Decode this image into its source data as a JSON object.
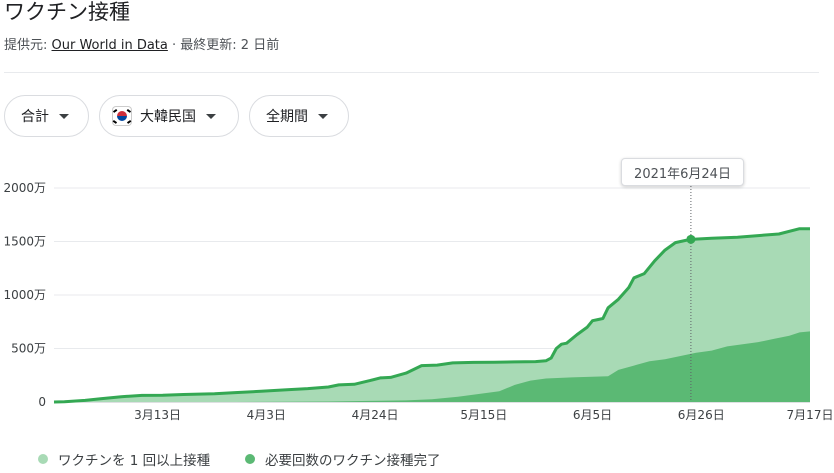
{
  "header": {
    "title": "ワクチン接種",
    "source_prefix": "提供元: ",
    "source_link": "Our World in Data",
    "source_suffix": " · 最終更新: 2 日前"
  },
  "filters": {
    "total_label": "合計",
    "country_label": "大韓民国",
    "period_label": "全期間"
  },
  "tooltip": {
    "date": "2021年6月24日"
  },
  "legend": {
    "items": [
      {
        "label": "ワクチンを 1 回以上接種",
        "color": "#a8dab5"
      },
      {
        "label": "必要回数のワクチン接種完了",
        "color": "#5bb974"
      }
    ]
  },
  "colors": {
    "line": "#34a853",
    "area_one_dose": "#a8dab5",
    "area_full": "#5bb974",
    "grid": "#e8eaed"
  },
  "chart_data": {
    "type": "area",
    "y_unit": "万",
    "ylim": [
      0,
      2000
    ],
    "y_ticks": [
      {
        "value": 0,
        "label": "0"
      },
      {
        "value": 500,
        "label": "500万"
      },
      {
        "value": 1000,
        "label": "1000万"
      },
      {
        "value": 1500,
        "label": "1500万"
      },
      {
        "value": 2000,
        "label": "2000万"
      }
    ],
    "x_ticks": [
      {
        "day": 45,
        "label": "3月13日"
      },
      {
        "day": 66,
        "label": "4月3日"
      },
      {
        "day": 87,
        "label": "4月24日"
      },
      {
        "day": 108,
        "label": "5月15日"
      },
      {
        "day": 129,
        "label": "6月5日"
      },
      {
        "day": 150,
        "label": "6月26日"
      },
      {
        "day": 171,
        "label": "7月17日"
      }
    ],
    "xlim": [
      25,
      171
    ],
    "highlight": {
      "day": 148,
      "value": 1520
    },
    "series": [
      {
        "name": "ワクチンを 1 回以上接種",
        "points": [
          [
            25,
            0
          ],
          [
            27,
            2
          ],
          [
            31,
            15
          ],
          [
            34,
            30
          ],
          [
            38,
            50
          ],
          [
            42,
            62
          ],
          [
            46,
            64
          ],
          [
            50,
            70
          ],
          [
            56,
            78
          ],
          [
            60,
            88
          ],
          [
            65,
            100
          ],
          [
            70,
            115
          ],
          [
            74,
            125
          ],
          [
            78,
            140
          ],
          [
            80,
            160
          ],
          [
            83,
            165
          ],
          [
            86,
            200
          ],
          [
            88,
            225
          ],
          [
            90,
            230
          ],
          [
            93,
            270
          ],
          [
            96,
            340
          ],
          [
            99,
            345
          ],
          [
            102,
            365
          ],
          [
            106,
            370
          ],
          [
            110,
            372
          ],
          [
            114,
            375
          ],
          [
            118,
            378
          ],
          [
            120,
            385
          ],
          [
            121,
            410
          ],
          [
            122,
            500
          ],
          [
            123,
            540
          ],
          [
            124,
            550
          ],
          [
            126,
            630
          ],
          [
            128,
            700
          ],
          [
            129,
            760
          ],
          [
            130,
            770
          ],
          [
            131,
            780
          ],
          [
            132,
            880
          ],
          [
            134,
            960
          ],
          [
            136,
            1070
          ],
          [
            137,
            1160
          ],
          [
            138,
            1180
          ],
          [
            139,
            1200
          ],
          [
            141,
            1320
          ],
          [
            143,
            1420
          ],
          [
            145,
            1490
          ],
          [
            147,
            1510
          ],
          [
            148,
            1520
          ],
          [
            152,
            1530
          ],
          [
            157,
            1540
          ],
          [
            161,
            1555
          ],
          [
            165,
            1570
          ],
          [
            169,
            1620
          ],
          [
            171,
            1620
          ]
        ]
      },
      {
        "name": "必要回数のワクチン接種完了",
        "points": [
          [
            25,
            0
          ],
          [
            45,
            0
          ],
          [
            60,
            0
          ],
          [
            78,
            5
          ],
          [
            86,
            10
          ],
          [
            93,
            15
          ],
          [
            98,
            25
          ],
          [
            103,
            50
          ],
          [
            107,
            75
          ],
          [
            111,
            100
          ],
          [
            114,
            160
          ],
          [
            117,
            200
          ],
          [
            120,
            220
          ],
          [
            125,
            230
          ],
          [
            132,
            240
          ],
          [
            134,
            300
          ],
          [
            137,
            340
          ],
          [
            140,
            380
          ],
          [
            143,
            400
          ],
          [
            146,
            430
          ],
          [
            149,
            460
          ],
          [
            152,
            480
          ],
          [
            155,
            520
          ],
          [
            158,
            540
          ],
          [
            161,
            560
          ],
          [
            164,
            590
          ],
          [
            167,
            620
          ],
          [
            169,
            650
          ],
          [
            171,
            660
          ]
        ]
      }
    ]
  }
}
